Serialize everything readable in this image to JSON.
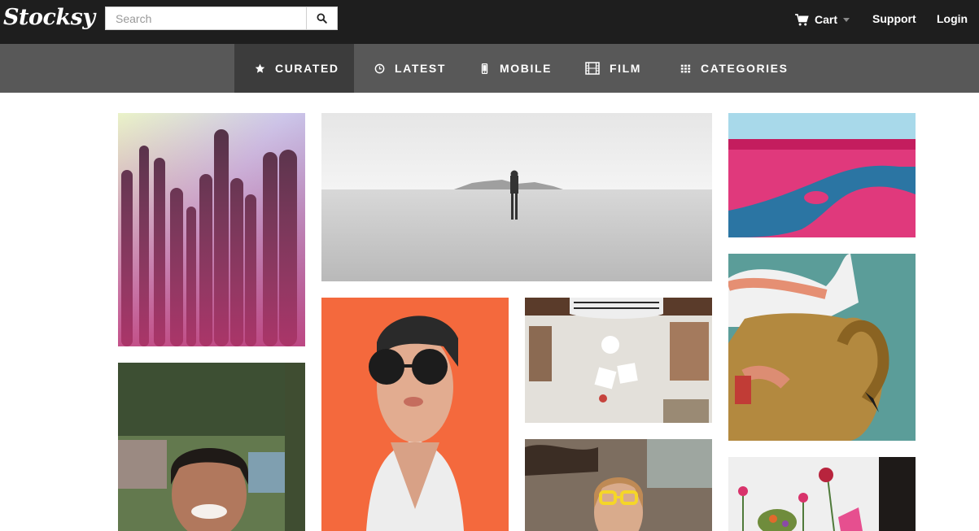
{
  "brand": {
    "logo_text": "Stocksy"
  },
  "search": {
    "placeholder": "Search"
  },
  "header": {
    "cart_label": "Cart",
    "support_label": "Support",
    "login_label": "Login"
  },
  "nav": {
    "items": [
      {
        "label": "CURATED",
        "icon": "star-icon",
        "active": true
      },
      {
        "label": "LATEST",
        "icon": "clock-icon",
        "active": false
      },
      {
        "label": "MOBILE",
        "icon": "mobile-icon",
        "active": false
      },
      {
        "label": "FILM",
        "icon": "film-icon",
        "active": false
      },
      {
        "label": "CATEGORIES",
        "icon": "grid-icon",
        "active": false
      }
    ]
  },
  "gallery": {
    "photos": [
      {
        "subject": "cactus"
      },
      {
        "subject": "desert-figure"
      },
      {
        "subject": "pink-landscape-river"
      },
      {
        "subject": "woman-sunglasses-orange"
      },
      {
        "subject": "crafting-table"
      },
      {
        "subject": "inflatable-swan"
      },
      {
        "subject": "smiling-boy"
      },
      {
        "subject": "girl-yellow-glasses"
      },
      {
        "subject": "flowers-vase"
      }
    ]
  },
  "colors": {
    "topbar": "#1e1e1e",
    "navbar": "#585858",
    "nav_active": "#3c3c3c"
  }
}
